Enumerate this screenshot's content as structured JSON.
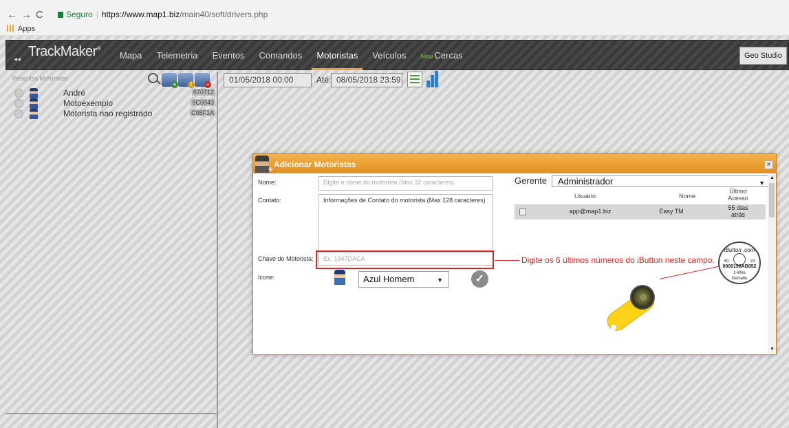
{
  "browser": {
    "secure_label": "Seguro",
    "url_host": "https://www.map1.biz",
    "url_path": "/main40/soft/drivers.php",
    "apps_label": "Apps"
  },
  "topnav": {
    "logo": "TrackMaker",
    "logo_mark": "®",
    "collapse_icon": "double-chevron-left-icon",
    "items": [
      "Mapa",
      "Telemetria",
      "Eventos",
      "Comandos",
      "Motoristas",
      "Veículos",
      "Cercas"
    ],
    "active_index": 4,
    "new_badge": "New",
    "geo_studio": "Geo Studio",
    "accent_color": "#e8a33b"
  },
  "sidebar": {
    "search_placeholder": "Pesquisa Motoristas",
    "icons": [
      "search-icon",
      "add-driver-icon",
      "alert-driver-icon",
      "remove-driver-icon"
    ],
    "drivers": [
      {
        "name": "André",
        "code": "670712"
      },
      {
        "name": "Motoexemplo",
        "code": "9C0943"
      },
      {
        "name": "Motorista nao registrado",
        "code": "C08F1A"
      }
    ]
  },
  "datebar": {
    "from": "01/05/2018 00:00",
    "to_label": "Até:",
    "to": "08/05/2018 23:59",
    "icons": [
      "checklist-icon",
      "bar-chart-icon"
    ]
  },
  "modal": {
    "title": "Adicionar Motoristas",
    "header_color": "#e8a33b",
    "close": "×",
    "nome_label": "Nome:",
    "nome_placeholder": "Digite o nome do motorista (Max 32 caracteres)",
    "contato_label": "Contato:",
    "contato_value": "Informações de Contato do motorista (Max 128 caracteres)",
    "chave_label": "Chave do Motorista:",
    "chave_placeholder": "Ex: 1347DACA",
    "icone_label": "Icone:",
    "icone_value": "Azul Homem",
    "gerente_label": "Gerente",
    "gerente_value": "Administrador",
    "table_headers": [
      "Usuário",
      "Nome",
      "Último Acesso"
    ],
    "table_rows": [
      {
        "usuario": "app@map1.biz",
        "nome": "Easy TM",
        "acesso": "55 dias atrás"
      }
    ]
  },
  "annotation": {
    "text": "Digite os 6 últimos números do iButton neste campo.",
    "color": "#d92828"
  },
  "ibutton_label": {
    "brand": "iButton .com",
    "left_num": "40",
    "right_num": "24",
    "serial": "0000158AB852",
    "wire": "1-Wire",
    "bottom": "Gemalto"
  }
}
